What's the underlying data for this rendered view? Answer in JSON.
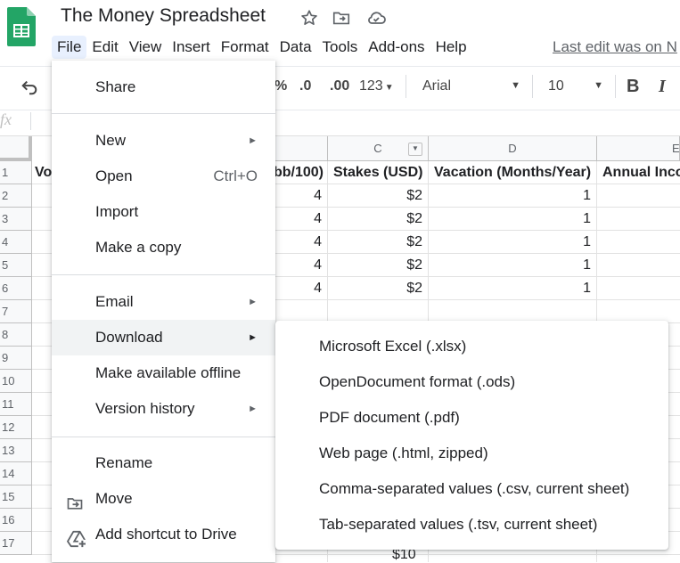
{
  "doc": {
    "title": "The Money Spreadsheet",
    "last_edit": "Last edit was on N"
  },
  "menubar": [
    "File",
    "Edit",
    "View",
    "Insert",
    "Format",
    "Data",
    "Tools",
    "Add-ons",
    "Help"
  ],
  "toolbar": {
    "percent": "%",
    "dec_decrease": ".0",
    "dec_increase": ".00",
    "number_format": "123",
    "font": "Arial",
    "font_size": "10",
    "bold": "B",
    "italic": "I"
  },
  "formula_bar": {
    "fx": "fx"
  },
  "columns": [
    "C",
    "D",
    "E"
  ],
  "rows": [
    "1",
    "2",
    "3",
    "4",
    "5",
    "6",
    "7",
    "8",
    "9",
    "10",
    "11",
    "12",
    "13",
    "14",
    "15",
    "16",
    "17"
  ],
  "sheet": {
    "a1_partial": "Vo",
    "b1_partial": "bb/100)",
    "c1": "Stakes (USD)",
    "d1": "Vacation (Months/Year)",
    "e1_partial": "Annual Inco",
    "b_values": [
      "4",
      "4",
      "4",
      "4",
      "4"
    ],
    "c_values": [
      "$2",
      "$2",
      "$2",
      "$2",
      "$2"
    ],
    "d_values": [
      "1",
      "1",
      "1",
      "1",
      "1"
    ],
    "c17_partial": "$10"
  },
  "file_menu": {
    "share": "Share",
    "new": "New",
    "open": "Open",
    "open_shortcut": "Ctrl+O",
    "import": "Import",
    "make_copy": "Make a copy",
    "email": "Email",
    "download": "Download",
    "offline": "Make available offline",
    "version_history": "Version history",
    "rename": "Rename",
    "move": "Move",
    "add_shortcut": "Add shortcut to Drive"
  },
  "download_submenu": [
    "Microsoft Excel (.xlsx)",
    "OpenDocument format (.ods)",
    "PDF document (.pdf)",
    "Web page (.html, zipped)",
    "Comma-separated values (.csv, current sheet)",
    "Tab-separated values (.tsv, current sheet)"
  ],
  "colors": {
    "sheets_green": "#23a566",
    "menu_highlight": "#f1f3f4",
    "active_menu": "#e8f0fe"
  },
  "icons": [
    "sheets-logo-icon",
    "star-icon",
    "move-folder-icon",
    "cloud-status-icon",
    "undo-icon",
    "submenu-arrow-icon",
    "move-icon",
    "add-shortcut-drive-icon",
    "filter-icon"
  ]
}
